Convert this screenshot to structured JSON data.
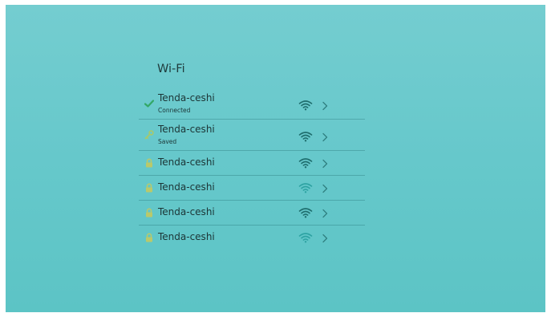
{
  "page": {
    "title": "Wi-Fi"
  },
  "colors": {
    "check": "#33a866",
    "key": "#a8c96a",
    "lock": "#b9c96b",
    "signal_strong": "#1f6e6e",
    "signal_weak": "#2ea3a3",
    "chevron": "#2f7f80"
  },
  "networks": [
    {
      "ssid": "Tenda-ceshi",
      "status": "Connected",
      "status_icon": "check-icon",
      "signal": "strong"
    },
    {
      "ssid": "Tenda-ceshi",
      "status": "Saved",
      "status_icon": "key-icon",
      "signal": "strong"
    },
    {
      "ssid": "Tenda-ceshi",
      "status": "",
      "status_icon": "lock-icon",
      "signal": "strong"
    },
    {
      "ssid": "Tenda-ceshi",
      "status": "",
      "status_icon": "lock-icon",
      "signal": "weak"
    },
    {
      "ssid": "Tenda-ceshi",
      "status": "",
      "status_icon": "lock-icon",
      "signal": "strong"
    },
    {
      "ssid": "Tenda-ceshi",
      "status": "",
      "status_icon": "lock-icon",
      "signal": "weak"
    }
  ]
}
